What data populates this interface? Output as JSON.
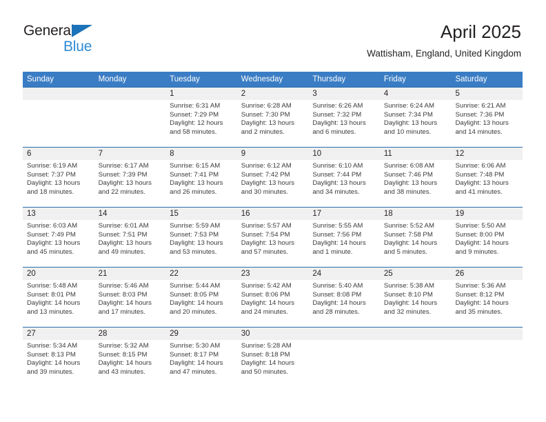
{
  "brand": {
    "name_part1": "General",
    "name_part2": "Blue",
    "triangle_icon": "triangle-icon"
  },
  "header": {
    "title": "April 2025",
    "subtitle": "Wattisham, England, United Kingdom"
  },
  "colors": {
    "header_blue": "#3b7dc4",
    "rule_blue": "#2b6cae",
    "brand_blue": "#2b8ad6",
    "day_strip_gray": "#f0f0f0",
    "text_dark": "#231f20"
  },
  "weekdays": [
    "Sunday",
    "Monday",
    "Tuesday",
    "Wednesday",
    "Thursday",
    "Friday",
    "Saturday"
  ],
  "weeks": [
    [
      {
        "day": "",
        "sunrise": "",
        "sunset": "",
        "daylight1": "",
        "daylight2": ""
      },
      {
        "day": "",
        "sunrise": "",
        "sunset": "",
        "daylight1": "",
        "daylight2": ""
      },
      {
        "day": "1",
        "sunrise": "Sunrise: 6:31 AM",
        "sunset": "Sunset: 7:29 PM",
        "daylight1": "Daylight: 12 hours",
        "daylight2": "and 58 minutes."
      },
      {
        "day": "2",
        "sunrise": "Sunrise: 6:28 AM",
        "sunset": "Sunset: 7:30 PM",
        "daylight1": "Daylight: 13 hours",
        "daylight2": "and 2 minutes."
      },
      {
        "day": "3",
        "sunrise": "Sunrise: 6:26 AM",
        "sunset": "Sunset: 7:32 PM",
        "daylight1": "Daylight: 13 hours",
        "daylight2": "and 6 minutes."
      },
      {
        "day": "4",
        "sunrise": "Sunrise: 6:24 AM",
        "sunset": "Sunset: 7:34 PM",
        "daylight1": "Daylight: 13 hours",
        "daylight2": "and 10 minutes."
      },
      {
        "day": "5",
        "sunrise": "Sunrise: 6:21 AM",
        "sunset": "Sunset: 7:36 PM",
        "daylight1": "Daylight: 13 hours",
        "daylight2": "and 14 minutes."
      }
    ],
    [
      {
        "day": "6",
        "sunrise": "Sunrise: 6:19 AM",
        "sunset": "Sunset: 7:37 PM",
        "daylight1": "Daylight: 13 hours",
        "daylight2": "and 18 minutes."
      },
      {
        "day": "7",
        "sunrise": "Sunrise: 6:17 AM",
        "sunset": "Sunset: 7:39 PM",
        "daylight1": "Daylight: 13 hours",
        "daylight2": "and 22 minutes."
      },
      {
        "day": "8",
        "sunrise": "Sunrise: 6:15 AM",
        "sunset": "Sunset: 7:41 PM",
        "daylight1": "Daylight: 13 hours",
        "daylight2": "and 26 minutes."
      },
      {
        "day": "9",
        "sunrise": "Sunrise: 6:12 AM",
        "sunset": "Sunset: 7:42 PM",
        "daylight1": "Daylight: 13 hours",
        "daylight2": "and 30 minutes."
      },
      {
        "day": "10",
        "sunrise": "Sunrise: 6:10 AM",
        "sunset": "Sunset: 7:44 PM",
        "daylight1": "Daylight: 13 hours",
        "daylight2": "and 34 minutes."
      },
      {
        "day": "11",
        "sunrise": "Sunrise: 6:08 AM",
        "sunset": "Sunset: 7:46 PM",
        "daylight1": "Daylight: 13 hours",
        "daylight2": "and 38 minutes."
      },
      {
        "day": "12",
        "sunrise": "Sunrise: 6:06 AM",
        "sunset": "Sunset: 7:48 PM",
        "daylight1": "Daylight: 13 hours",
        "daylight2": "and 41 minutes."
      }
    ],
    [
      {
        "day": "13",
        "sunrise": "Sunrise: 6:03 AM",
        "sunset": "Sunset: 7:49 PM",
        "daylight1": "Daylight: 13 hours",
        "daylight2": "and 45 minutes."
      },
      {
        "day": "14",
        "sunrise": "Sunrise: 6:01 AM",
        "sunset": "Sunset: 7:51 PM",
        "daylight1": "Daylight: 13 hours",
        "daylight2": "and 49 minutes."
      },
      {
        "day": "15",
        "sunrise": "Sunrise: 5:59 AM",
        "sunset": "Sunset: 7:53 PM",
        "daylight1": "Daylight: 13 hours",
        "daylight2": "and 53 minutes."
      },
      {
        "day": "16",
        "sunrise": "Sunrise: 5:57 AM",
        "sunset": "Sunset: 7:54 PM",
        "daylight1": "Daylight: 13 hours",
        "daylight2": "and 57 minutes."
      },
      {
        "day": "17",
        "sunrise": "Sunrise: 5:55 AM",
        "sunset": "Sunset: 7:56 PM",
        "daylight1": "Daylight: 14 hours",
        "daylight2": "and 1 minute."
      },
      {
        "day": "18",
        "sunrise": "Sunrise: 5:52 AM",
        "sunset": "Sunset: 7:58 PM",
        "daylight1": "Daylight: 14 hours",
        "daylight2": "and 5 minutes."
      },
      {
        "day": "19",
        "sunrise": "Sunrise: 5:50 AM",
        "sunset": "Sunset: 8:00 PM",
        "daylight1": "Daylight: 14 hours",
        "daylight2": "and 9 minutes."
      }
    ],
    [
      {
        "day": "20",
        "sunrise": "Sunrise: 5:48 AM",
        "sunset": "Sunset: 8:01 PM",
        "daylight1": "Daylight: 14 hours",
        "daylight2": "and 13 minutes."
      },
      {
        "day": "21",
        "sunrise": "Sunrise: 5:46 AM",
        "sunset": "Sunset: 8:03 PM",
        "daylight1": "Daylight: 14 hours",
        "daylight2": "and 17 minutes."
      },
      {
        "day": "22",
        "sunrise": "Sunrise: 5:44 AM",
        "sunset": "Sunset: 8:05 PM",
        "daylight1": "Daylight: 14 hours",
        "daylight2": "and 20 minutes."
      },
      {
        "day": "23",
        "sunrise": "Sunrise: 5:42 AM",
        "sunset": "Sunset: 8:06 PM",
        "daylight1": "Daylight: 14 hours",
        "daylight2": "and 24 minutes."
      },
      {
        "day": "24",
        "sunrise": "Sunrise: 5:40 AM",
        "sunset": "Sunset: 8:08 PM",
        "daylight1": "Daylight: 14 hours",
        "daylight2": "and 28 minutes."
      },
      {
        "day": "25",
        "sunrise": "Sunrise: 5:38 AM",
        "sunset": "Sunset: 8:10 PM",
        "daylight1": "Daylight: 14 hours",
        "daylight2": "and 32 minutes."
      },
      {
        "day": "26",
        "sunrise": "Sunrise: 5:36 AM",
        "sunset": "Sunset: 8:12 PM",
        "daylight1": "Daylight: 14 hours",
        "daylight2": "and 35 minutes."
      }
    ],
    [
      {
        "day": "27",
        "sunrise": "Sunrise: 5:34 AM",
        "sunset": "Sunset: 8:13 PM",
        "daylight1": "Daylight: 14 hours",
        "daylight2": "and 39 minutes."
      },
      {
        "day": "28",
        "sunrise": "Sunrise: 5:32 AM",
        "sunset": "Sunset: 8:15 PM",
        "daylight1": "Daylight: 14 hours",
        "daylight2": "and 43 minutes."
      },
      {
        "day": "29",
        "sunrise": "Sunrise: 5:30 AM",
        "sunset": "Sunset: 8:17 PM",
        "daylight1": "Daylight: 14 hours",
        "daylight2": "and 47 minutes."
      },
      {
        "day": "30",
        "sunrise": "Sunrise: 5:28 AM",
        "sunset": "Sunset: 8:18 PM",
        "daylight1": "Daylight: 14 hours",
        "daylight2": "and 50 minutes."
      },
      {
        "day": "",
        "sunrise": "",
        "sunset": "",
        "daylight1": "",
        "daylight2": ""
      },
      {
        "day": "",
        "sunrise": "",
        "sunset": "",
        "daylight1": "",
        "daylight2": ""
      },
      {
        "day": "",
        "sunrise": "",
        "sunset": "",
        "daylight1": "",
        "daylight2": ""
      }
    ]
  ]
}
